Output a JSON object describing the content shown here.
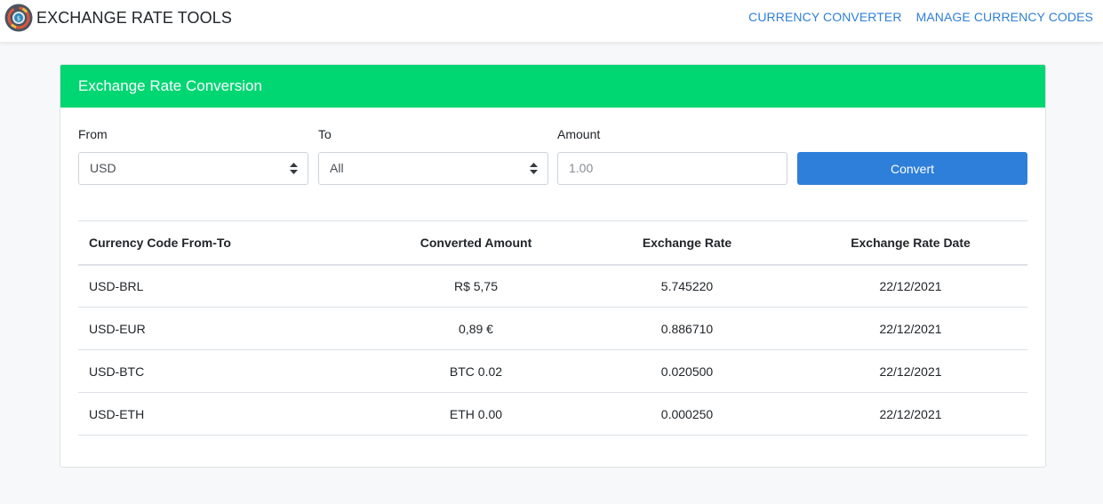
{
  "app": {
    "title": "EXCHANGE RATE TOOLS",
    "nav": [
      {
        "label": "CURRENCY CONVERTER"
      },
      {
        "label": "MANAGE CURRENCY CODES"
      }
    ]
  },
  "colors": {
    "accent_green": "#00d672",
    "link_blue": "#2f7fd6",
    "button_blue": "#2e7fd9"
  },
  "card": {
    "title": "Exchange Rate Conversion",
    "form": {
      "from": {
        "label": "From",
        "value": "USD"
      },
      "to": {
        "label": "To",
        "value": "All"
      },
      "amount": {
        "label": "Amount",
        "placeholder": "1.00"
      },
      "convert_label": "Convert"
    },
    "table": {
      "headers": [
        "Currency Code From-To",
        "Converted Amount",
        "Exchange Rate",
        "Exchange Rate Date"
      ],
      "rows": [
        [
          "USD-BRL",
          "R$ 5,75",
          "5.745220",
          "22/12/2021"
        ],
        [
          "USD-EUR",
          "0,89 €",
          "0.886710",
          "22/12/2021"
        ],
        [
          "USD-BTC",
          "BTC 0.02",
          "0.020500",
          "22/12/2021"
        ],
        [
          "USD-ETH",
          "ETH 0.00",
          "0.000250",
          "22/12/2021"
        ]
      ]
    }
  }
}
